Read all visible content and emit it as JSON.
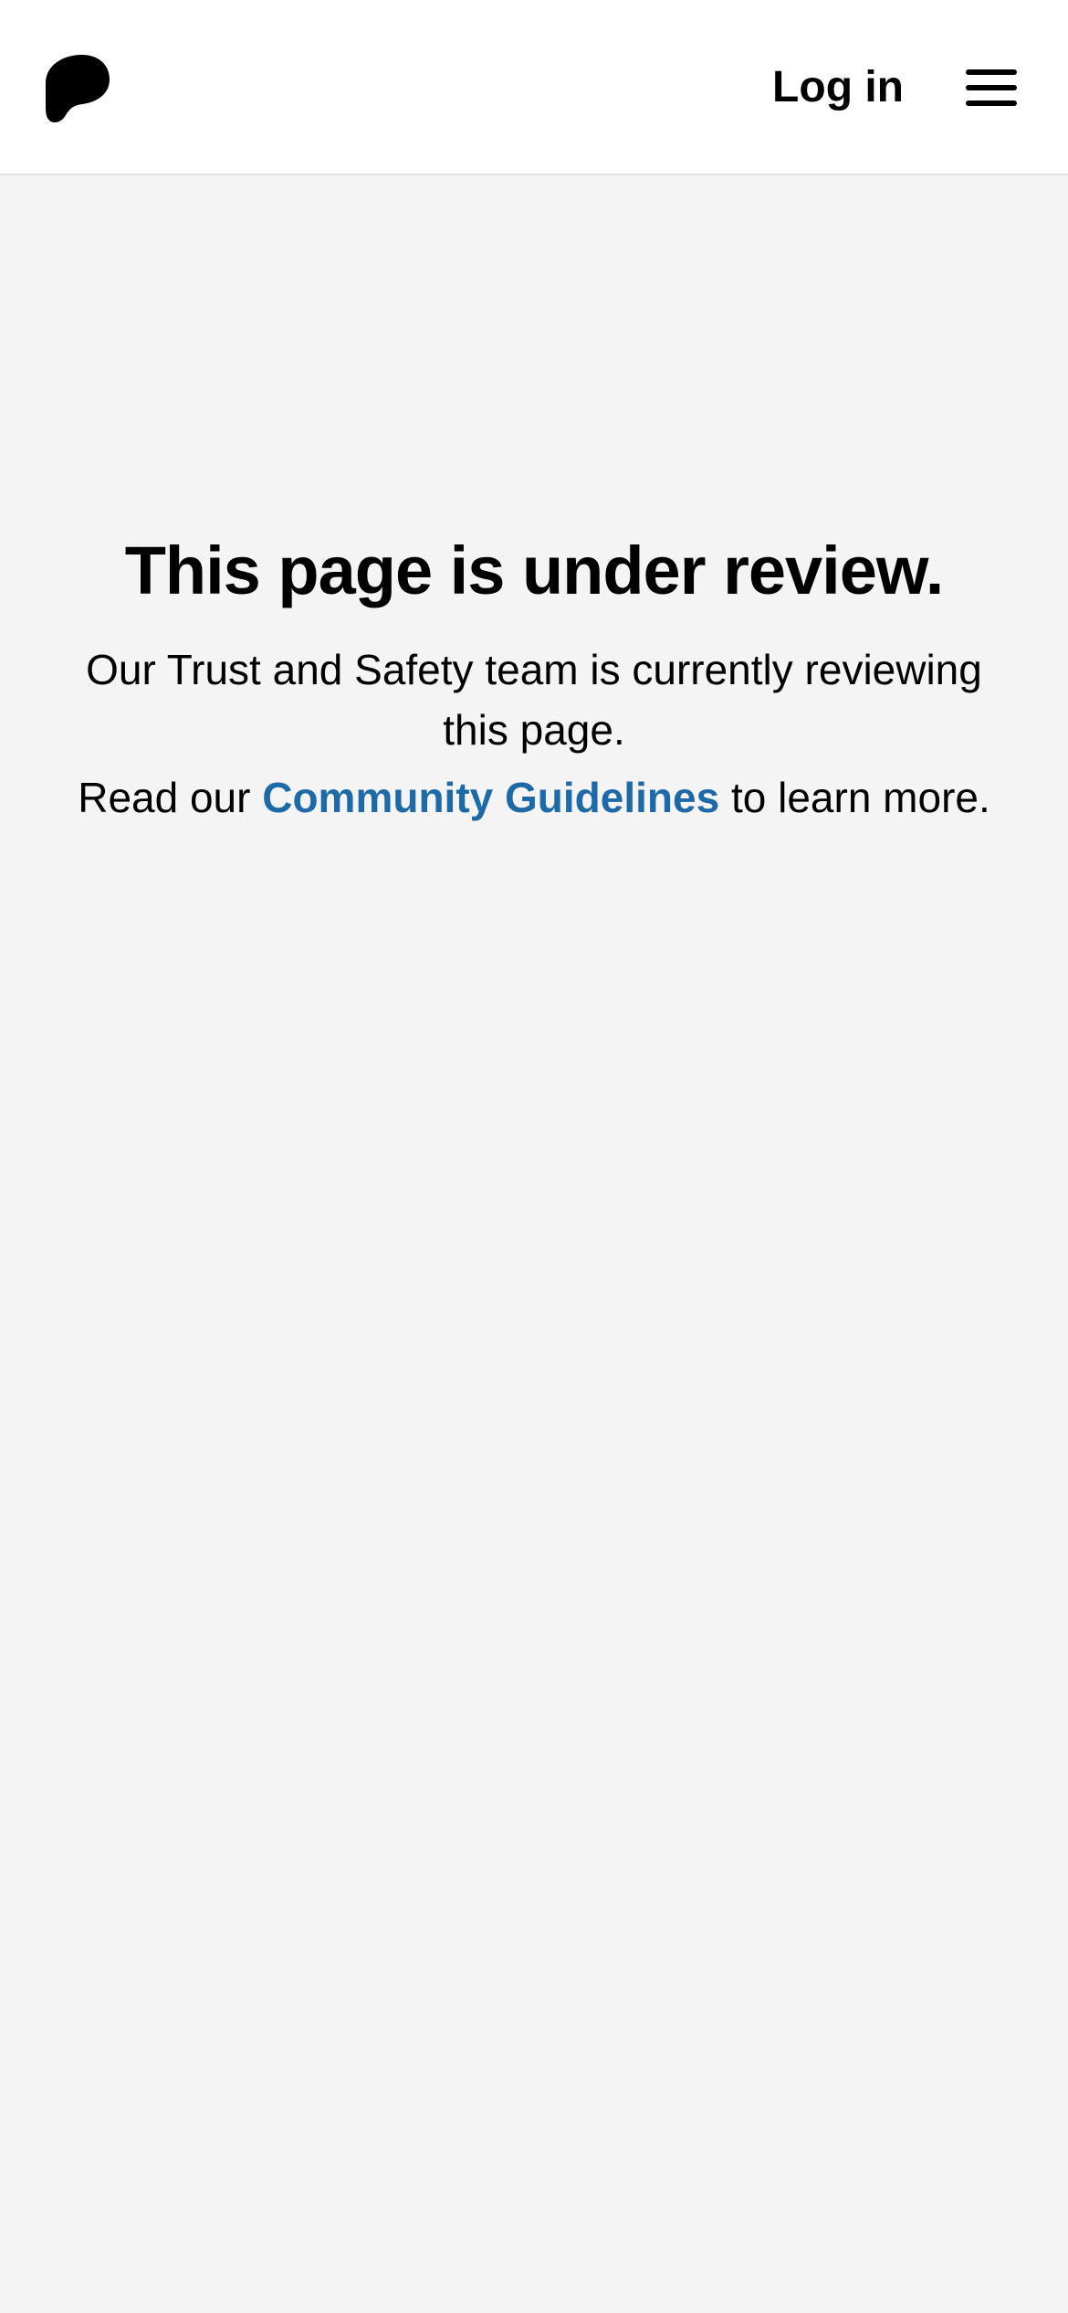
{
  "header": {
    "logo_icon": "patreon-logo-icon",
    "login_label": "Log in",
    "menu_icon": "hamburger-menu-icon"
  },
  "main": {
    "title": "This page is under review.",
    "description": "Our Trust and Safety team is currently reviewing this page.",
    "read_prefix": "Read our",
    "guidelines_link": "Community Guidelines",
    "read_suffix": "to learn more."
  },
  "colors": {
    "background": "#f4f4f4",
    "header_background": "#ffffff",
    "link": "#1e6aa8",
    "text": "#000000"
  }
}
